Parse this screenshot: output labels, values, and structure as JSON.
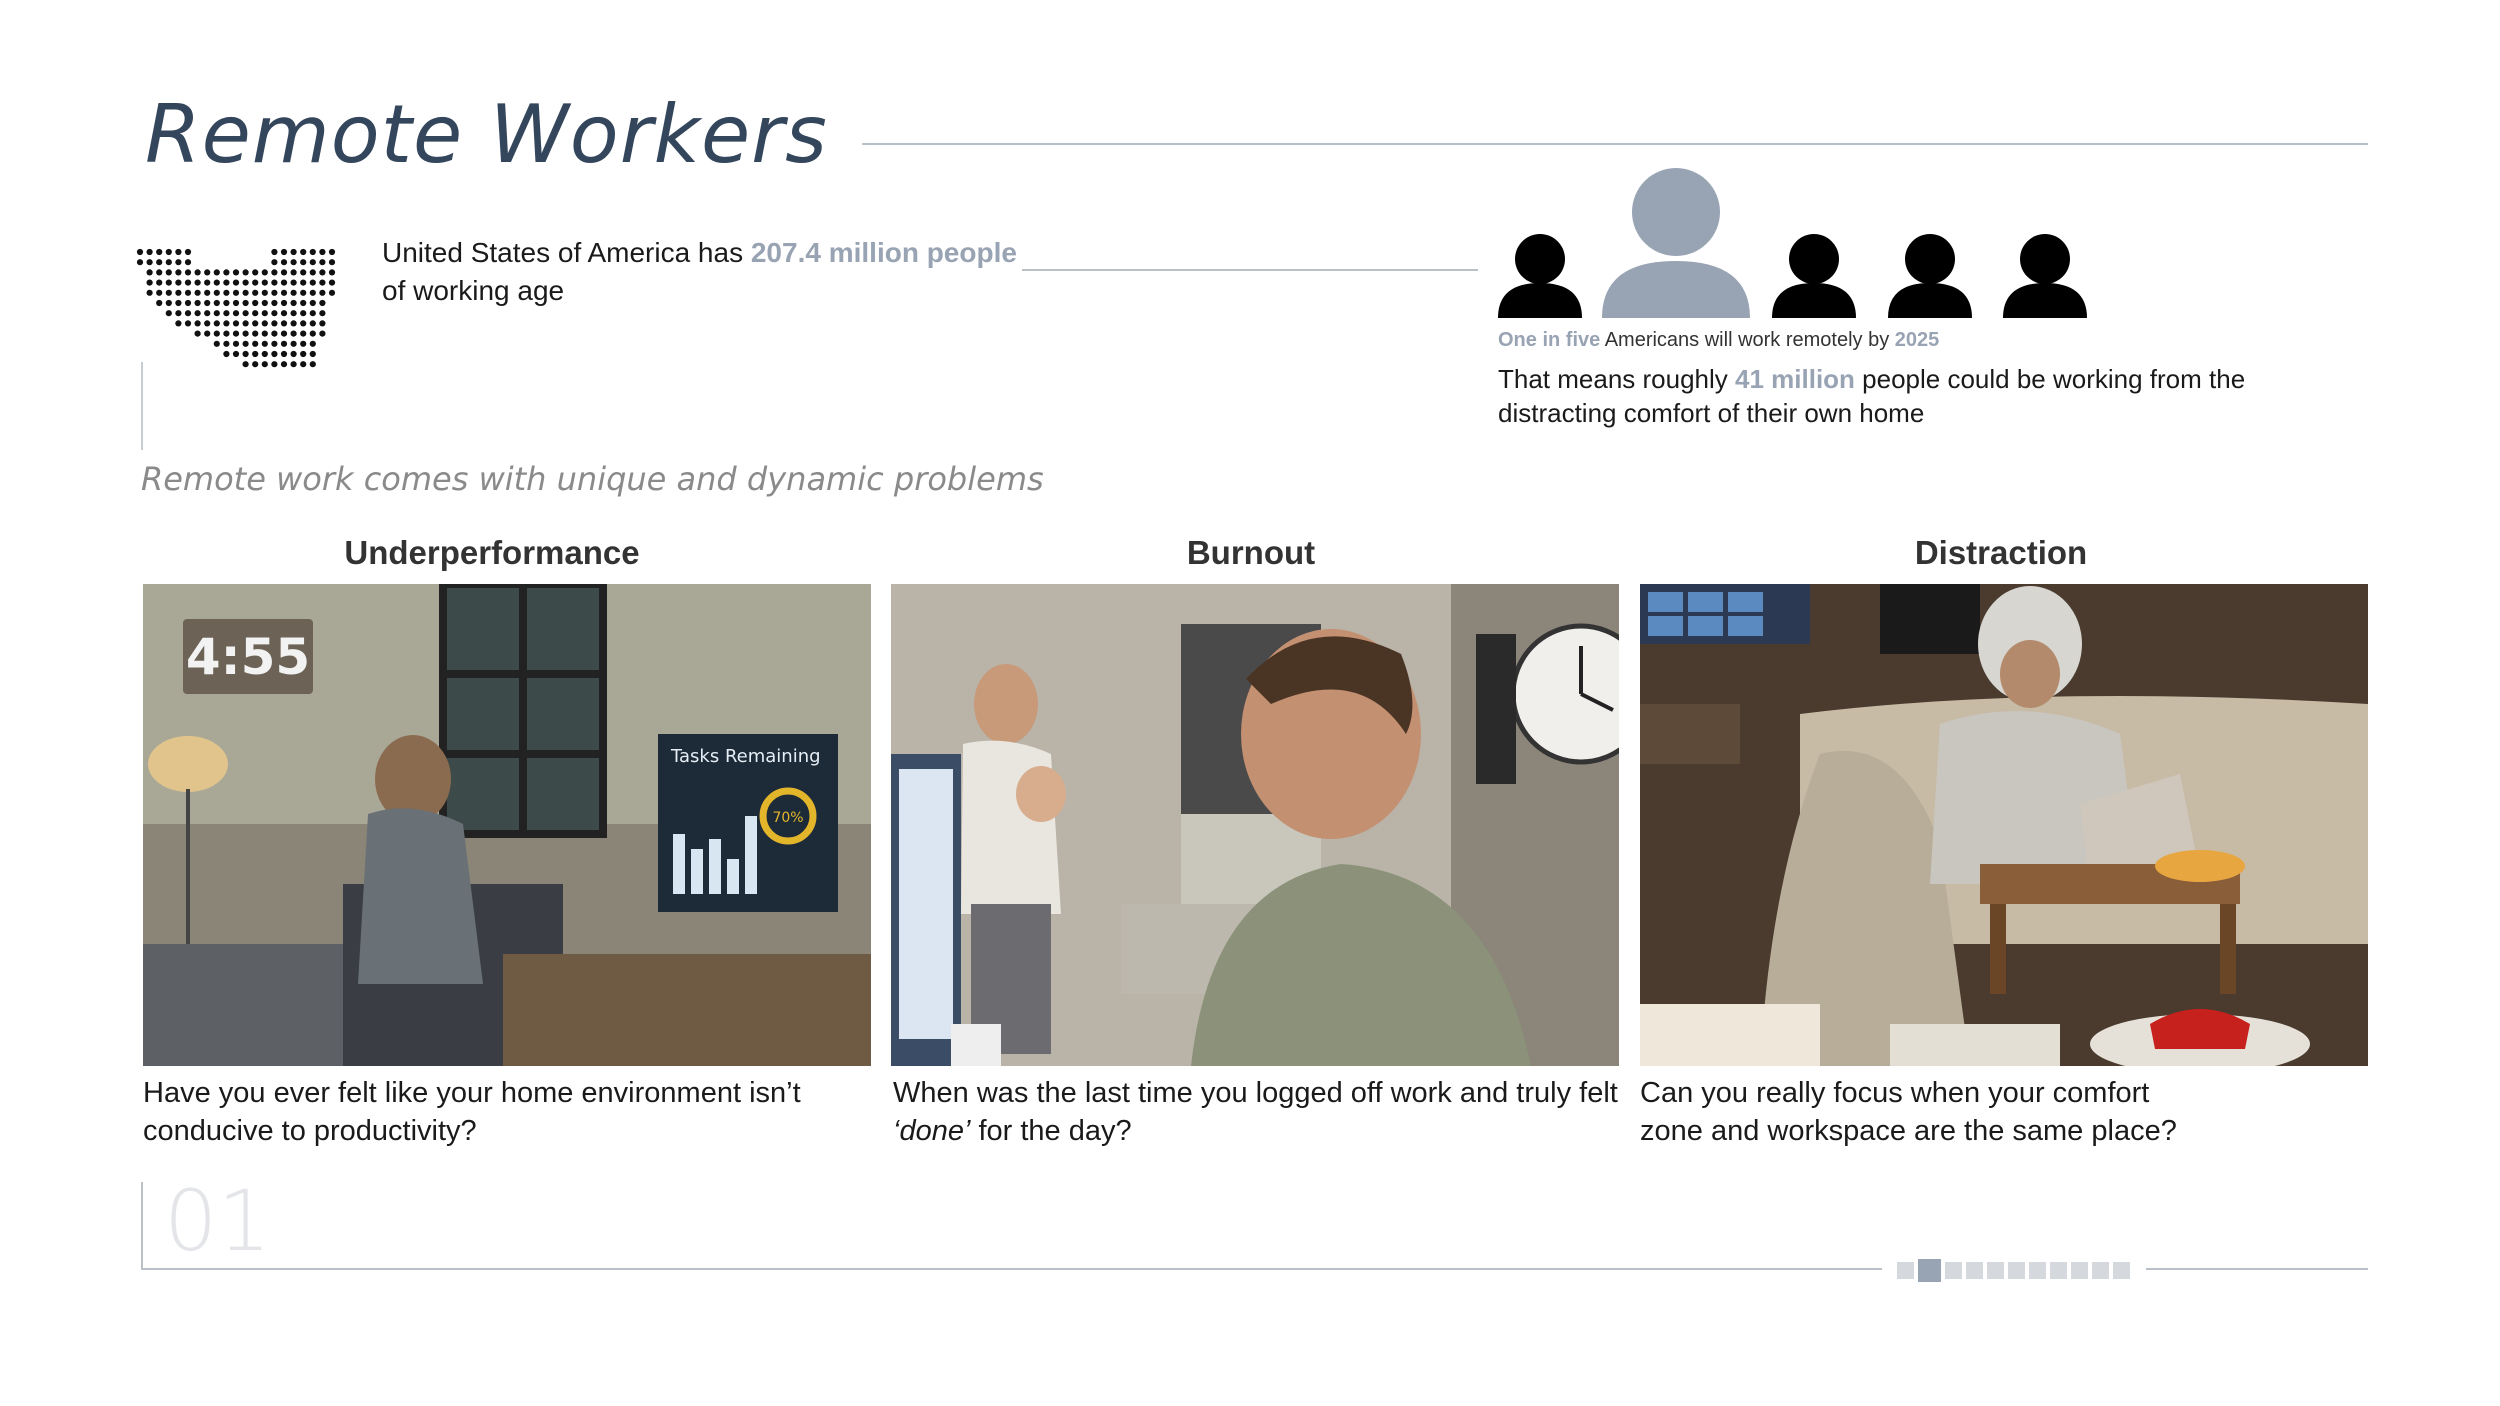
{
  "title": "Remote Workers",
  "population": {
    "prefix": "United States of America has ",
    "highlight": "207.4 million people",
    "suffix": " of working age"
  },
  "remote": {
    "ratio_highlight": "One in five",
    "ratio_text": " Americans will work remotely by ",
    "year": "2025",
    "detail_prefix": "That means roughly ",
    "detail_highlight": "41 million",
    "detail_suffix": " people could be working from the distracting comfort of their own home"
  },
  "tagline": "Remote work comes with unique and dynamic problems",
  "problems": [
    {
      "heading": "Underperformance",
      "clock": "4:55",
      "monitor_title": "Tasks Remaining",
      "monitor_value": "70%",
      "caption": "Have you ever felt like your home environment isn’t conducive to productivity?"
    },
    {
      "heading": "Burnout",
      "caption_pre": "When was the last time you logged off work and truly felt ",
      "caption_em": "‘done’",
      "caption_post": " for the day?"
    },
    {
      "heading": "Distraction",
      "caption": "Can you really focus when your comfort zone and workspace are the same place?"
    }
  ],
  "slide_number": "01",
  "pager": {
    "total": 11,
    "current": 2
  },
  "colors": {
    "accent": "#98a3b3",
    "title": "#34465c",
    "rule": "#b9c0c8"
  }
}
